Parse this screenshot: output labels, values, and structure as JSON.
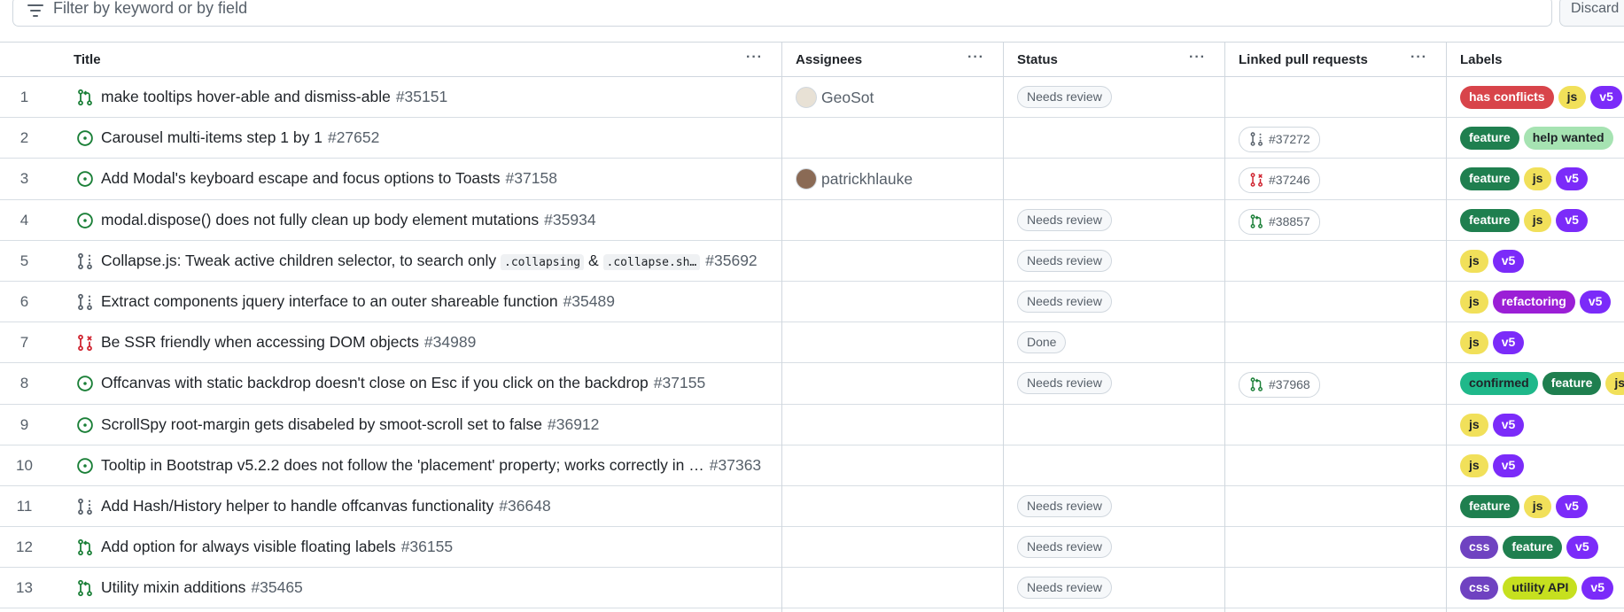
{
  "filter": {
    "placeholder": "Filter by keyword or by field",
    "discard_label": "Discard"
  },
  "columns": {
    "title": "Title",
    "assignees": "Assignees",
    "status": "Status",
    "linked": "Linked pull requests",
    "labels": "Labels",
    "menu_glyph": "···"
  },
  "label_colors": {
    "has conflicts": {
      "bg": "#d8444a",
      "fg": "#ffffff"
    },
    "js": {
      "bg": "#f1e05a",
      "fg": "#1f2328"
    },
    "v5": {
      "bg": "#7b2bf9",
      "fg": "#ffffff"
    },
    "feature": {
      "bg": "#1f7f4f",
      "fg": "#ffffff"
    },
    "help wanted": {
      "bg": "#a6e3b2",
      "fg": "#1f2328"
    },
    "refactoring": {
      "bg": "#9b1fd6",
      "fg": "#ffffff"
    },
    "confirmed": {
      "bg": "#1fb88a",
      "fg": "#1f2328"
    },
    "css": {
      "bg": "#6f42c1",
      "fg": "#ffffff"
    },
    "utility API": {
      "bg": "#c6e01f",
      "fg": "#1f2328"
    }
  },
  "rows": [
    {
      "num": "1",
      "type": "pr-open",
      "title": "make tooltips hover-able and dismiss-able",
      "issue": "#35151",
      "assignee": "GeoSot",
      "avatar_color": "#e8e1d5",
      "status": "Needs review",
      "linked": "",
      "linked_type": "",
      "labels": [
        "has conflicts",
        "js",
        "v5"
      ]
    },
    {
      "num": "2",
      "type": "issue-open",
      "title": "Carousel multi-items step 1 by 1",
      "issue": "#27652",
      "assignee": "",
      "status": "",
      "linked": "#37272",
      "linked_type": "pr-draft",
      "labels": [
        "feature",
        "help wanted"
      ]
    },
    {
      "num": "3",
      "type": "issue-open",
      "title": "Add Modal's keyboard escape and focus options to Toasts",
      "issue": "#37158",
      "assignee": "patrickhlauke",
      "avatar_color": "#8a6a55",
      "status": "",
      "linked": "#37246",
      "linked_type": "pr-closed",
      "labels": [
        "feature",
        "js",
        "v5"
      ]
    },
    {
      "num": "4",
      "type": "issue-open",
      "title": "modal.dispose() does not fully clean up body element mutations",
      "issue": "#35934",
      "assignee": "",
      "status": "Needs review",
      "linked": "#38857",
      "linked_type": "pr-open",
      "labels": [
        "feature",
        "js",
        "v5"
      ]
    },
    {
      "num": "5",
      "type": "pr-draft",
      "title_parts": [
        "Collapse.js: Tweak active children selector, to search only ",
        ".collapsing",
        " & ",
        ".collapse.sh…"
      ],
      "issue": "#35692",
      "assignee": "",
      "status": "Needs review",
      "linked": "",
      "linked_type": "",
      "labels": [
        "js",
        "v5"
      ]
    },
    {
      "num": "6",
      "type": "pr-draft",
      "title": "Extract components jquery interface to an outer shareable function",
      "issue": "#35489",
      "assignee": "",
      "status": "Needs review",
      "linked": "",
      "linked_type": "",
      "labels": [
        "js",
        "refactoring",
        "v5"
      ]
    },
    {
      "num": "7",
      "type": "pr-closed",
      "title": "Be SSR friendly when accessing DOM objects",
      "issue": "#34989",
      "assignee": "",
      "status": "Done",
      "linked": "",
      "linked_type": "",
      "labels": [
        "js",
        "v5"
      ]
    },
    {
      "num": "8",
      "type": "issue-open",
      "title": "Offcanvas with static backdrop doesn't close on Esc if you click on the backdrop",
      "issue": "#37155",
      "assignee": "",
      "status": "Needs review",
      "linked": "#37968",
      "linked_type": "pr-open",
      "labels": [
        "confirmed",
        "feature",
        "js"
      ]
    },
    {
      "num": "9",
      "type": "issue-open",
      "title": "ScrollSpy root-margin gets disabeled by smoot-scroll set to false",
      "issue": "#36912",
      "assignee": "",
      "status": "",
      "linked": "",
      "linked_type": "",
      "labels": [
        "js",
        "v5"
      ]
    },
    {
      "num": "10",
      "type": "issue-open",
      "title": "Tooltip in Bootstrap v5.2.2 does not follow the 'placement' property; works correctly in …",
      "issue": "#37363",
      "assignee": "",
      "status": "",
      "linked": "",
      "linked_type": "",
      "labels": [
        "js",
        "v5"
      ]
    },
    {
      "num": "11",
      "type": "pr-draft",
      "title": "Add Hash/History helper to handle offcanvas functionality",
      "issue": "#36648",
      "assignee": "",
      "status": "Needs review",
      "linked": "",
      "linked_type": "",
      "labels": [
        "feature",
        "js",
        "v5"
      ]
    },
    {
      "num": "12",
      "type": "pr-open",
      "title": "Add option for always visible floating labels",
      "issue": "#36155",
      "assignee": "",
      "status": "Needs review",
      "linked": "",
      "linked_type": "",
      "labels": [
        "css",
        "feature",
        "v5"
      ]
    },
    {
      "num": "13",
      "type": "pr-open",
      "title": "Utility mixin additions",
      "issue": "#35465",
      "assignee": "",
      "status": "Needs review",
      "linked": "",
      "linked_type": "",
      "labels": [
        "css",
        "utility API",
        "v5"
      ]
    }
  ]
}
